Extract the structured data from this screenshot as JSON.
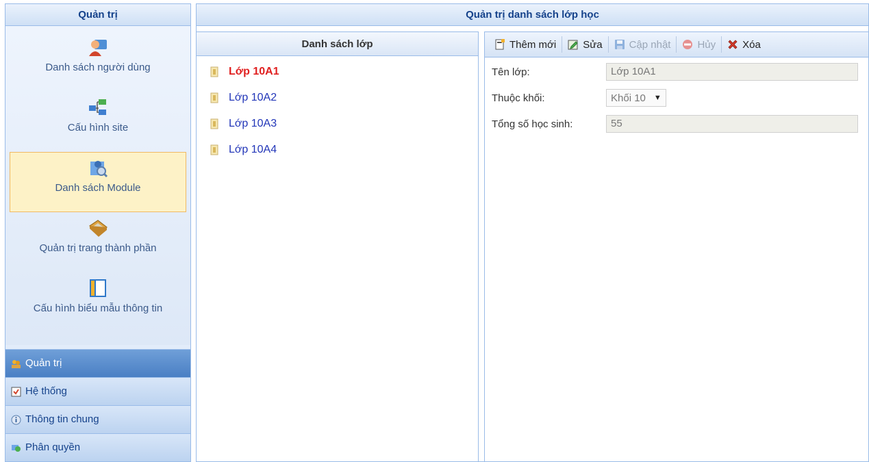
{
  "sidebar": {
    "title": "Quản trị",
    "modules": [
      {
        "label": "Danh sách người dùng",
        "icon": "users-icon"
      },
      {
        "label": "Cấu hình site",
        "icon": "site-config-icon"
      },
      {
        "label": "Danh sách Module",
        "icon": "module-list-icon"
      },
      {
        "label": "Quản trị trang thành phần",
        "icon": "component-page-icon"
      },
      {
        "label": "Cấu hình biểu mẫu thông tin",
        "icon": "form-template-icon"
      }
    ],
    "nav": [
      {
        "label": "Quản trị",
        "icon": "admin-icon"
      },
      {
        "label": "Hệ thống",
        "icon": "system-icon"
      },
      {
        "label": "Thông tin chung",
        "icon": "info-icon"
      },
      {
        "label": "Phân quyền",
        "icon": "permissions-icon"
      }
    ]
  },
  "main": {
    "title": "Quản trị danh sách lớp học",
    "class_list": {
      "title": "Danh sách lớp",
      "items": [
        "Lớp 10A1",
        "Lớp 10A2",
        "Lớp 10A3",
        "Lớp 10A4"
      ]
    },
    "toolbar": {
      "add": "Thêm mới",
      "edit": "Sửa",
      "update": "Cập nhật",
      "cancel": "Hủy",
      "delete": "Xóa"
    },
    "form": {
      "class_name_label": "Tên lớp:",
      "class_name_value": "Lớp 10A1",
      "grade_label": "Thuộc khối:",
      "grade_value": "Khối 10",
      "students_label": "Tổng số học sinh:",
      "students_value": "55"
    }
  },
  "colors": {
    "accent": "#15428b",
    "selected_text": "#e02020",
    "link_text": "#2135b8",
    "active_nav": "#4a7fc4",
    "active_module_bg": "#fdf2c7"
  }
}
